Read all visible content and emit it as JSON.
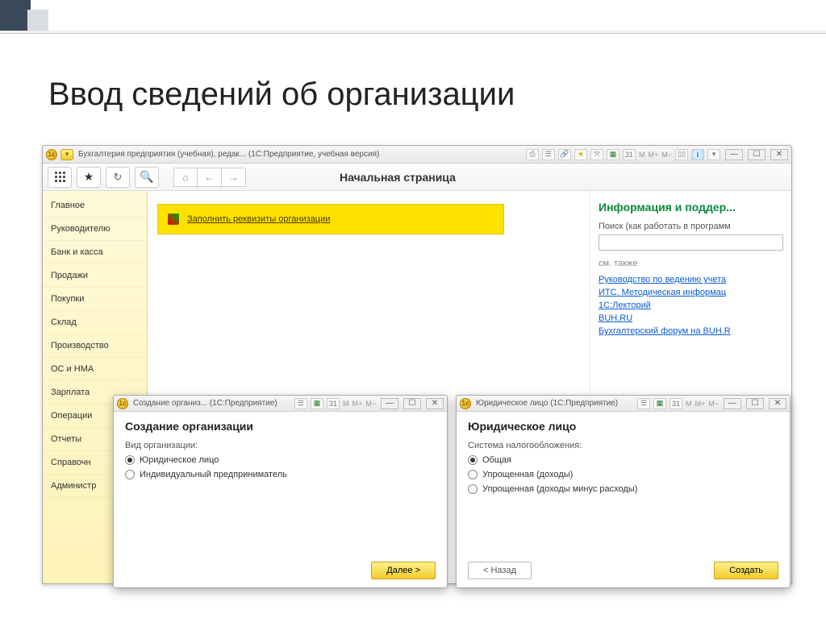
{
  "slide": {
    "title": "Ввод сведений об организации"
  },
  "window": {
    "title": "Бухгалтерия предприятия (учебная), редак... (1С:Предприятие, учебная версия)",
    "mem_m": "M",
    "mem_mplus": "M+",
    "mem_mminus": "M−"
  },
  "page": {
    "title": "Начальная страница"
  },
  "sidebar": {
    "items": [
      {
        "label": "Главное"
      },
      {
        "label": "Руководителю"
      },
      {
        "label": "Банк и касса"
      },
      {
        "label": "Продажи"
      },
      {
        "label": "Покупки"
      },
      {
        "label": "Склад"
      },
      {
        "label": "Производство"
      },
      {
        "label": "ОС и НМА"
      },
      {
        "label": "Зарплата"
      },
      {
        "label": "Операции"
      },
      {
        "label": "Отчеты"
      },
      {
        "label": "Справочн"
      },
      {
        "label": "Администр"
      }
    ]
  },
  "banner": {
    "link": "Заполнить реквизиты организации"
  },
  "info": {
    "title": "Информация и поддер...",
    "search_label": "Поиск (как работать в программ",
    "search_value": "",
    "see_also": "см. также",
    "links": [
      "Руководство по ведению учета",
      "ИТС. Методическая информац",
      "1С:Лекторий",
      "BUH.RU",
      "Бухгалтерский форум на BUH.R"
    ]
  },
  "dialog1": {
    "titlebar": "Создание организ... (1С:Предприятие)",
    "heading": "Создание организации",
    "label": "Вид организации:",
    "opt1": "Юридическое лицо",
    "opt2": "Индивидуальный предприниматель",
    "next": "Далее >"
  },
  "dialog2": {
    "titlebar": "Юридическое лицо (1С:Предприятие)",
    "heading": "Юридическое лицо",
    "label": "Система налогообложения:",
    "opt1": "Общая",
    "opt2": "Упрощенная (доходы)",
    "opt3": "Упрощенная (доходы минус расходы)",
    "back": "< Назад",
    "create": "Создать"
  }
}
